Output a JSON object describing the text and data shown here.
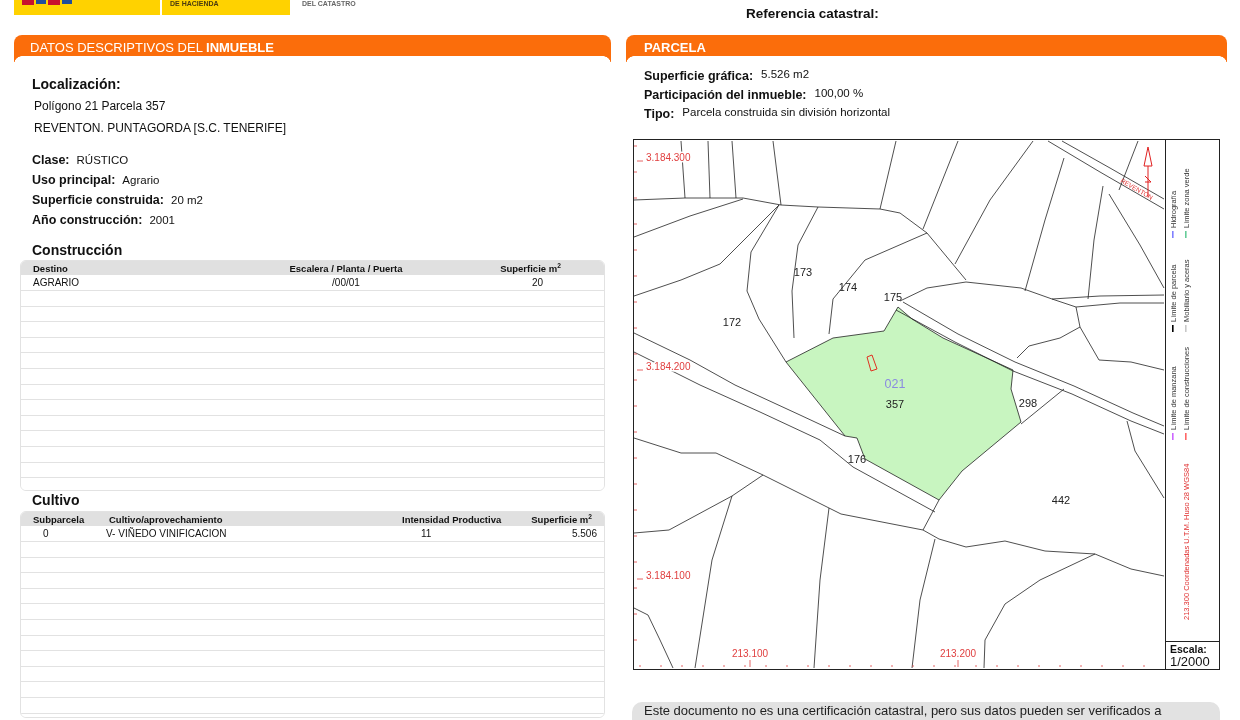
{
  "header": {
    "banner_text": "DE HACIENDA",
    "agency_text": "DEL CATASTRO",
    "reference_label": "Referencia catastral:"
  },
  "inmueble": {
    "title": "DATOS DESCRIPTIVOS DEL **INMUEBLE**",
    "location_label": "Localización:",
    "location_lines": [
      "Polígono 21 Parcela 357",
      "REVENTON. PUNTAGORDA [S.C. TENERIFE]"
    ],
    "fields": [
      {
        "label": "Clase:",
        "value": "RÚSTICO"
      },
      {
        "label": "Uso principal:",
        "value": "Agrario"
      },
      {
        "label": "Superficie construida:",
        "value": "20 m2"
      },
      {
        "label": "Año construcción:",
        "value": "2001"
      }
    ],
    "construccion": {
      "title": "Construcción",
      "columns": [
        "Destino",
        "Escalera / Planta / Puerta",
        "Superficie m$^{2}$"
      ],
      "rows": [
        [
          "AGRARIO",
          "/00/01",
          "20"
        ]
      ]
    },
    "cultivo": {
      "title": "Cultivo",
      "columns": [
        "Subparcela",
        "Cultivo/aprovechamiento",
        "Intensidad Productiva",
        "Superficie m$^{2}$"
      ],
      "rows": [
        [
          "0",
          "V- VIÑEDO VINIFICACION",
          "11",
          "5.506"
        ]
      ]
    }
  },
  "parcela": {
    "title": "PARCELA",
    "fields": [
      {
        "label": "Superficie gráfica:",
        "value": "5.526 m2"
      },
      {
        "label": "Participación del inmueble:",
        "value": "100,00 %"
      },
      {
        "label": "Tipo:",
        "value": "Parcela construida sin división horizontal"
      }
    ],
    "map": {
      "y_labels": [
        "3.184.300",
        "3.184.200",
        "3.184.100"
      ],
      "x_labels": [
        "213.100",
        "213.200"
      ],
      "street": "REVENTON",
      "polygon": "021",
      "parcel": "357",
      "neighbor_parcels": [
        "173",
        "174",
        "175",
        "172",
        "298",
        "176",
        "442"
      ],
      "legend": [
        {
          "label": "Hidrografía",
          "color": "#8080ff"
        },
        {
          "label": "Límite zona verde",
          "color": "#66cc99"
        },
        {
          "label": "Límite de parcela",
          "color": "#000000"
        },
        {
          "label": "Mobiliario y aceras",
          "color": "#c8c8c8"
        },
        {
          "label": "Límite de manzana",
          "color": "#cc66ff"
        },
        {
          "label": "Límite de construcciones",
          "color": "#ff6666"
        }
      ],
      "coordinate_system": "213.300 Coordenadas U.T.M. Huso 28 WGS84",
      "scale_label": "Escala:",
      "scale": "1/2000"
    }
  },
  "footer": {
    "text": "Este documento no es una certificación catastral, pero sus datos pueden ser verificados a"
  }
}
